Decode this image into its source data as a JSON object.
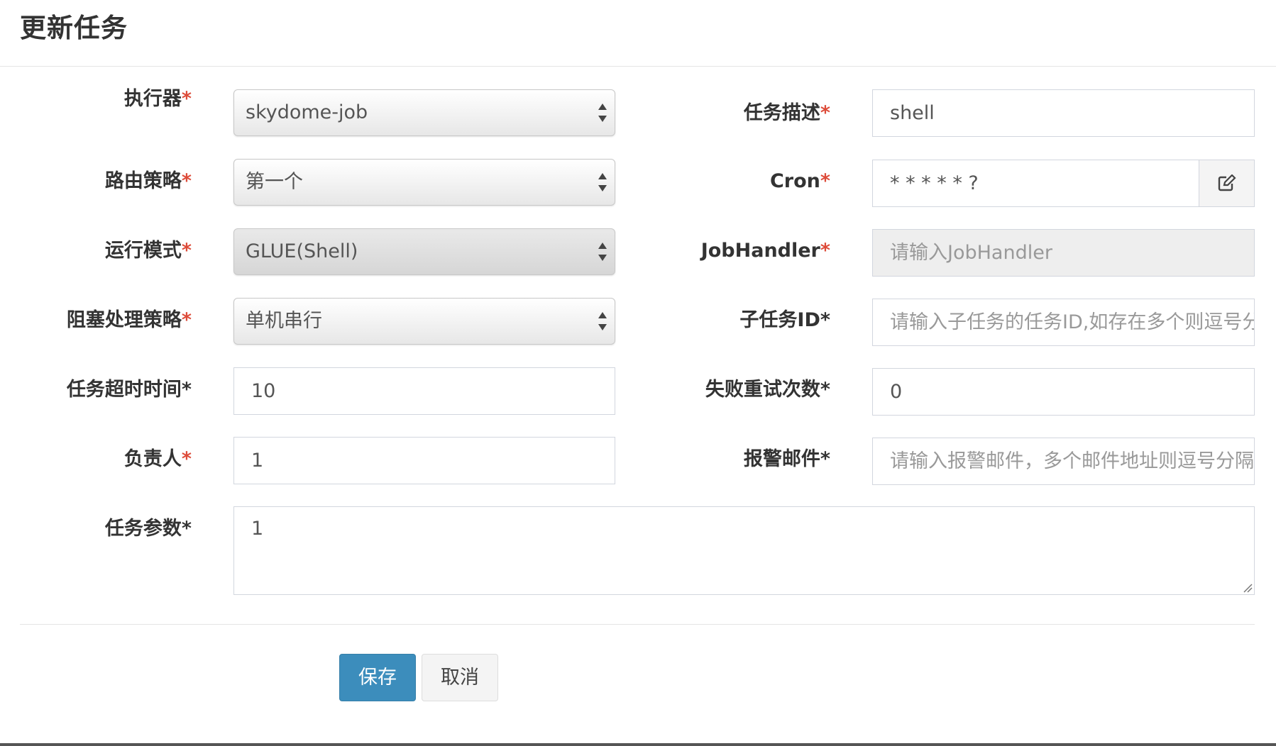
{
  "dialog": {
    "title": "更新任务"
  },
  "colors": {
    "required": "#dd4b39",
    "primary": "#3c8dbc"
  },
  "form": {
    "executor": {
      "label": "执行器",
      "value": "skydome-job"
    },
    "route_strategy": {
      "label": "路由策略",
      "value": "第一个"
    },
    "run_mode": {
      "label": "运行模式",
      "value": "GLUE(Shell)"
    },
    "block_strategy": {
      "label": "阻塞处理策略",
      "value": "单机串行"
    },
    "timeout": {
      "label": "任务超时时间",
      "value": "10"
    },
    "owner": {
      "label": "负责人",
      "value": "1"
    },
    "params": {
      "label": "任务参数",
      "value": "1"
    },
    "job_desc": {
      "label": "任务描述",
      "value": "shell"
    },
    "cron": {
      "label": "Cron",
      "value": "* * * * * ?",
      "icon": "edit-icon"
    },
    "job_handler": {
      "label": "JobHandler",
      "placeholder": "请输入JobHandler"
    },
    "child_job_id": {
      "label": "子任务ID",
      "placeholder": "请输入子任务的任务ID,如存在多个则逗号分隔"
    },
    "retry_count": {
      "label": "失败重试次数",
      "value": "0"
    },
    "alarm_email": {
      "label": "报警邮件",
      "placeholder": "请输入报警邮件，多个邮件地址则逗号分隔"
    },
    "required_mark": "*"
  },
  "buttons": {
    "save": "保存",
    "cancel": "取消"
  }
}
